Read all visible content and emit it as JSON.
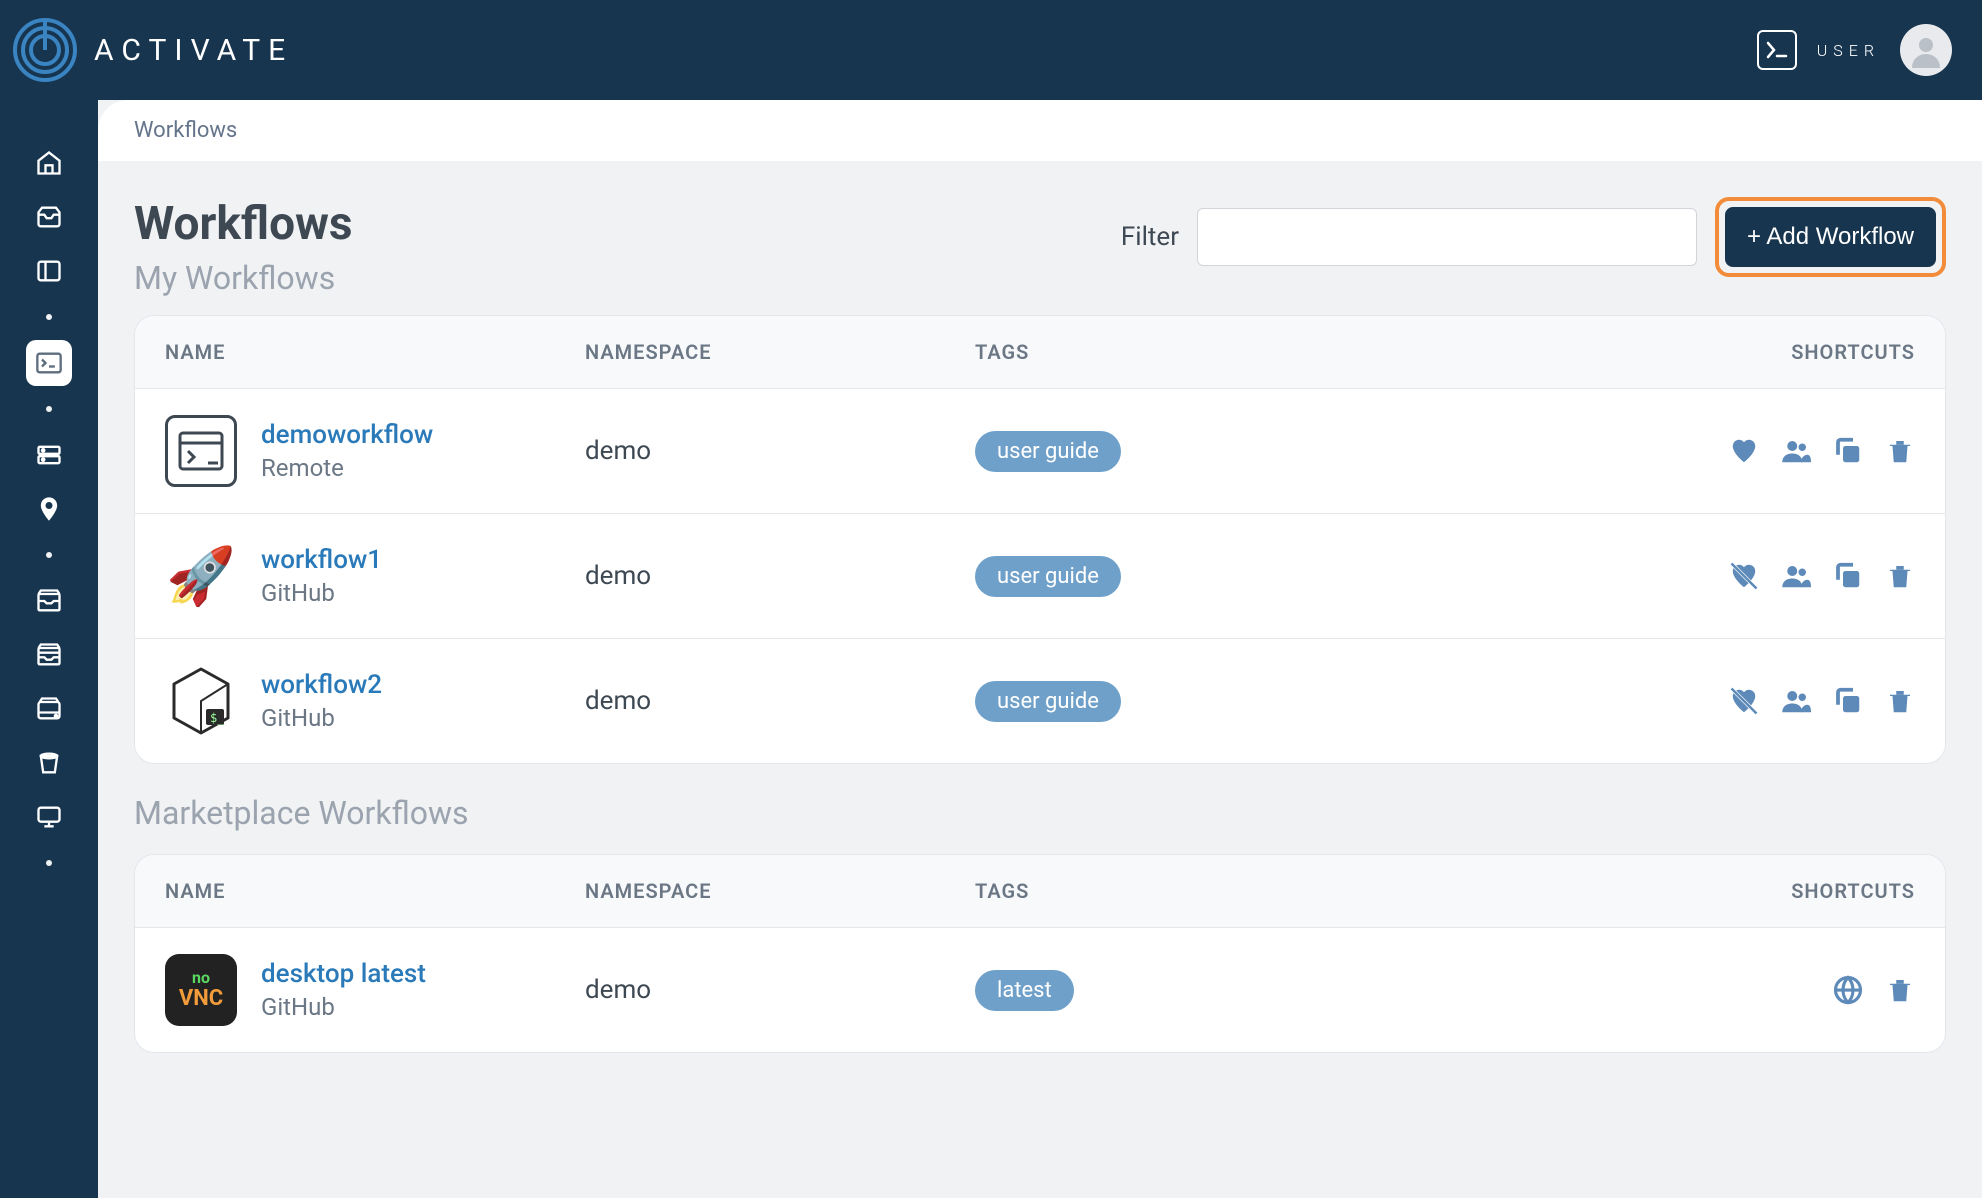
{
  "brand": {
    "name": "ACTIVATE"
  },
  "topbar": {
    "user_label": "USER"
  },
  "breadcrumb": {
    "text": "Workflows"
  },
  "page": {
    "title": "Workflows",
    "subtitle": "My Workflows",
    "filter_label": "Filter",
    "filter_value": "",
    "add_button": "+ Add Workflow"
  },
  "columns": {
    "name": "NAME",
    "namespace": "NAMESPACE",
    "tags": "TAGS",
    "shortcuts": "SHORTCUTS"
  },
  "my_workflows": [
    {
      "name": "demoworkflow",
      "source": "Remote",
      "namespace": "demo",
      "tag": "user guide",
      "icon": "browser",
      "fav": "heart"
    },
    {
      "name": "workflow1",
      "source": "GitHub",
      "namespace": "demo",
      "tag": "user guide",
      "icon": "rocket",
      "fav": "heart-off"
    },
    {
      "name": "workflow2",
      "source": "GitHub",
      "namespace": "demo",
      "tag": "user guide",
      "icon": "cube",
      "fav": "heart-off"
    }
  ],
  "marketplace_title": "Marketplace Workflows",
  "marketplace_workflows": [
    {
      "name": "desktop latest",
      "source": "GitHub",
      "namespace": "demo",
      "tag": "latest",
      "icon": "vnc"
    }
  ]
}
